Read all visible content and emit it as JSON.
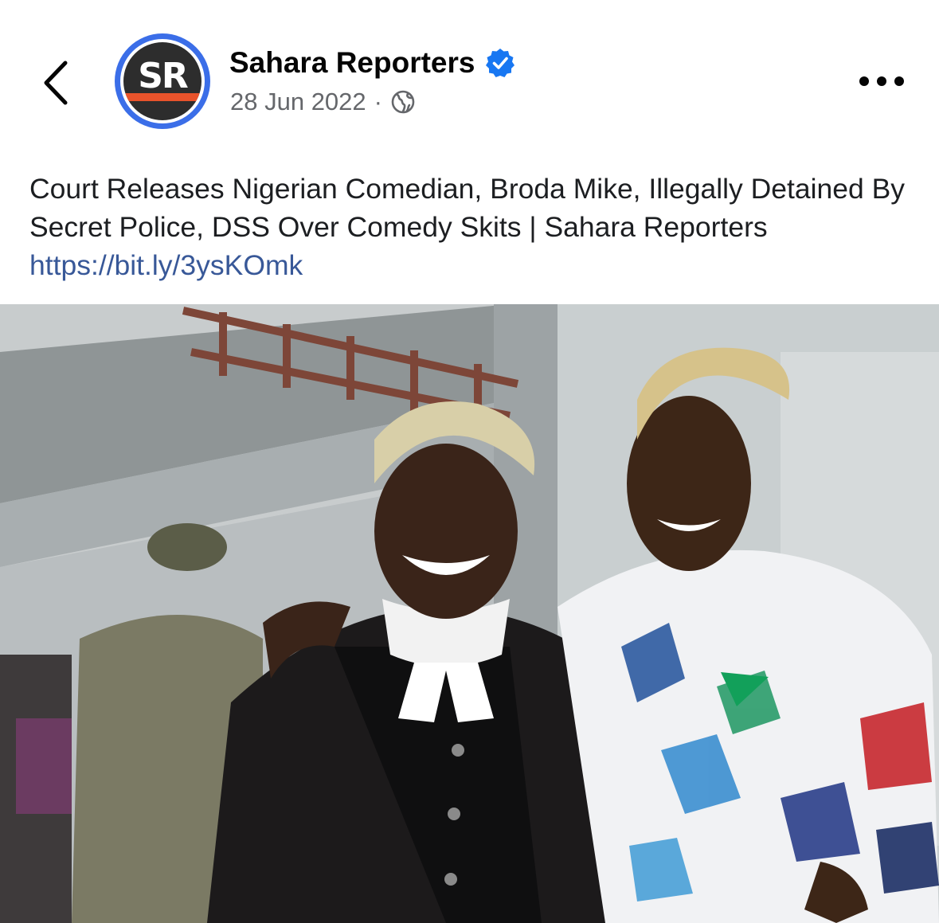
{
  "post": {
    "author": "Sahara Reporters",
    "avatar_initials": "SR",
    "date": "28 Jun 2022",
    "separator": "·",
    "privacy_icon": "globe-icon",
    "verified_icon": "verified-badge-icon",
    "text": "Court Releases Nigerian Comedian, Broda Mike, Illegally Detained By Secret Police, DSS Over Comedy Skits | Sahara Reporters",
    "link": "https://bit.ly/3ysKOmk"
  },
  "nav": {
    "back_icon": "chevron-left-icon",
    "more_icon": "more-dots-icon"
  },
  "colors": {
    "brand_blue": "#3b6ee8",
    "verified_blue": "#1877f2",
    "link_blue": "#385898",
    "meta_gray": "#65676b",
    "brand_orange": "#e9532b"
  }
}
